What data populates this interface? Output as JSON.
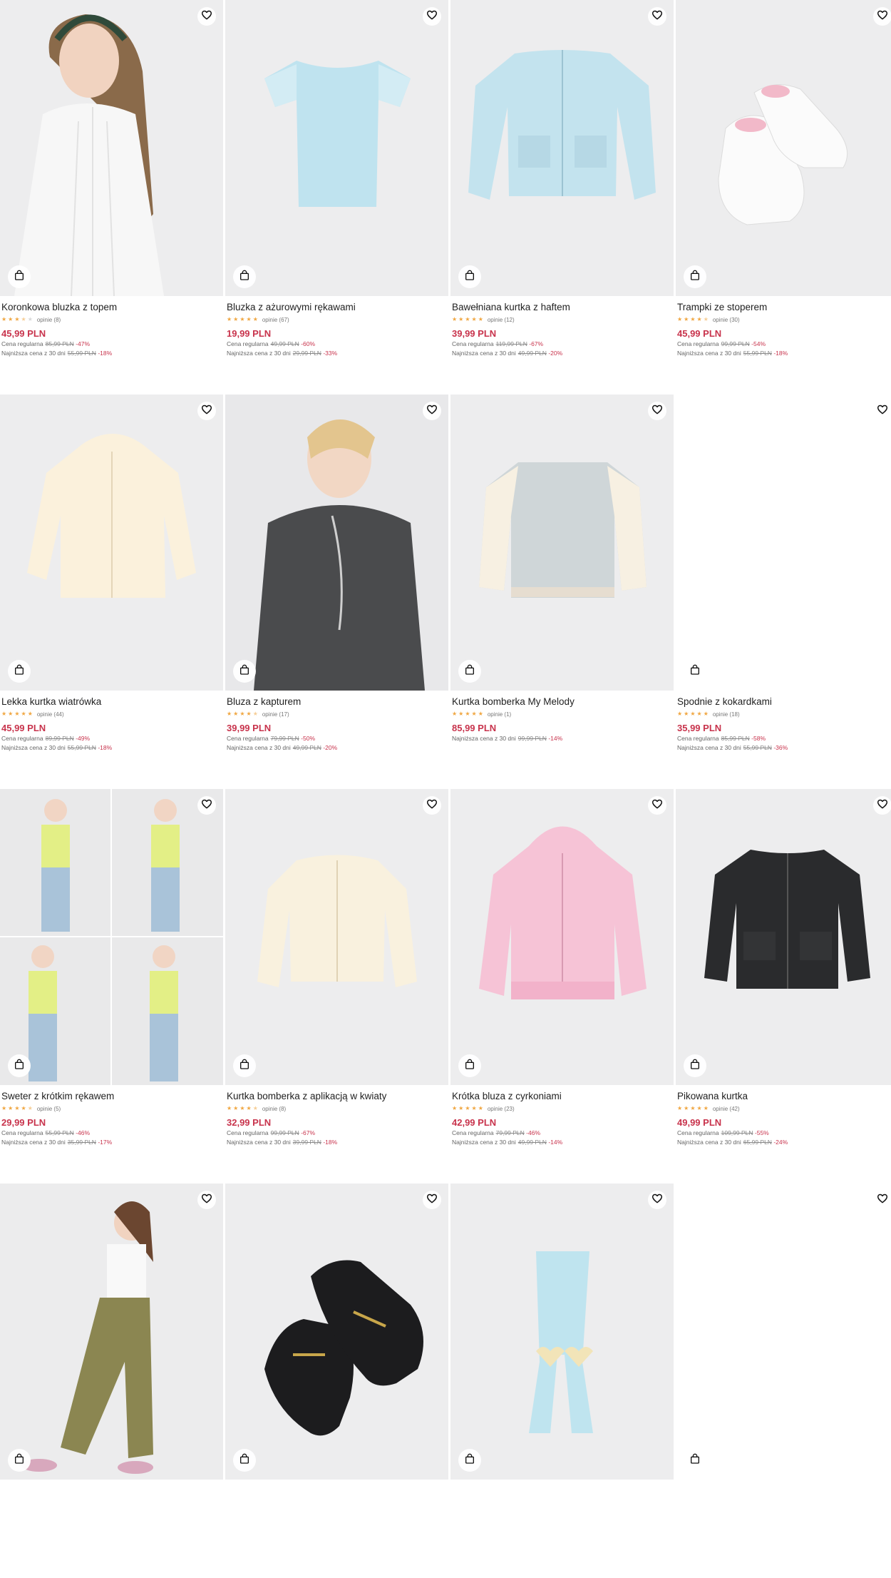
{
  "icons": {
    "wishlist": "heart-icon",
    "cart": "shopping-bag-icon",
    "rating": "star-icon"
  },
  "colors": {
    "price": "#c8334c",
    "star": "#f0a640",
    "image_bg": "#eeeeef"
  },
  "products": [
    {
      "name": "Koronkowa bluzka z topem",
      "rating": 3.5,
      "reviews": "opinie (8)",
      "price": "45,99 PLN",
      "lines": [
        {
          "label": "Cena regularna",
          "old": "85,99 PLN",
          "disc": "-47%"
        },
        {
          "label": "Najniższa cena z 30 dni",
          "old": "55,99 PLN",
          "disc": "-18%"
        }
      ]
    },
    {
      "name": "Bluzka z ażurowymi rękawami",
      "rating": 5,
      "reviews": "opinie (67)",
      "price": "19,99 PLN",
      "lines": [
        {
          "label": "Cena regularna",
          "old": "49,99 PLN",
          "disc": "-60%"
        },
        {
          "label": "Najniższa cena z 30 dni",
          "old": "29,99 PLN",
          "disc": "-33%"
        }
      ]
    },
    {
      "name": "Bawełniana kurtka z haftem",
      "rating": 5,
      "reviews": "opinie (12)",
      "price": "39,99 PLN",
      "lines": [
        {
          "label": "Cena regularna",
          "old": "119,99 PLN",
          "disc": "-67%"
        },
        {
          "label": "Najniższa cena z 30 dni",
          "old": "49,99 PLN",
          "disc": "-20%"
        }
      ]
    },
    {
      "name": "Trampki ze stoperem",
      "rating": 4.5,
      "reviews": "opinie (30)",
      "price": "45,99 PLN",
      "lines": [
        {
          "label": "Cena regularna",
          "old": "99,99 PLN",
          "disc": "-54%"
        },
        {
          "label": "Najniższa cena z 30 dni",
          "old": "55,99 PLN",
          "disc": "-18%"
        }
      ]
    },
    {
      "name": "Lekka kurtka wiatrówka",
      "rating": 5,
      "reviews": "opinie (44)",
      "price": "45,99 PLN",
      "lines": [
        {
          "label": "Cena regularna",
          "old": "89,99 PLN",
          "disc": "-49%"
        },
        {
          "label": "Najniższa cena z 30 dni",
          "old": "55,99 PLN",
          "disc": "-18%"
        }
      ]
    },
    {
      "name": "Bluza z kapturem",
      "rating": 4.5,
      "reviews": "opinie (17)",
      "price": "39,99 PLN",
      "lines": [
        {
          "label": "Cena regularna",
          "old": "79,99 PLN",
          "disc": "-50%"
        },
        {
          "label": "Najniższa cena z 30 dni",
          "old": "49,99 PLN",
          "disc": "-20%"
        }
      ]
    },
    {
      "name": "Kurtka bomberka My Melody",
      "rating": 5,
      "reviews": "opinie (1)",
      "price": "85,99 PLN",
      "lines": [
        {
          "label": "Najniższa cena z 30 dni",
          "old": "99,99 PLN",
          "disc": "-14%"
        }
      ]
    },
    {
      "name": "Spodnie z kokardkami",
      "rating": 5,
      "reviews": "opinie (18)",
      "price": "35,99 PLN",
      "lines": [
        {
          "label": "Cena regularna",
          "old": "85,99 PLN",
          "disc": "-58%"
        },
        {
          "label": "Najniższa cena z 30 dni",
          "old": "55,99 PLN",
          "disc": "-36%"
        }
      ]
    },
    {
      "name": "Sweter z krótkim rękawem",
      "rating": 4.5,
      "reviews": "opinie (5)",
      "price": "29,99 PLN",
      "lines": [
        {
          "label": "Cena regularna",
          "old": "55,99 PLN",
          "disc": "-46%"
        },
        {
          "label": "Najniższa cena z 30 dni",
          "old": "35,99 PLN",
          "disc": "-17%"
        }
      ]
    },
    {
      "name": "Kurtka bomberka z aplikacją w kwiaty",
      "rating": 4.5,
      "reviews": "opinie (8)",
      "price": "32,99 PLN",
      "lines": [
        {
          "label": "Cena regularna",
          "old": "99,99 PLN",
          "disc": "-67%"
        },
        {
          "label": "Najniższa cena z 30 dni",
          "old": "39,99 PLN",
          "disc": "-18%"
        }
      ]
    },
    {
      "name": "Krótka bluza z cyrkoniami",
      "rating": 5,
      "reviews": "opinie (23)",
      "price": "42,99 PLN",
      "lines": [
        {
          "label": "Cena regularna",
          "old": "79,99 PLN",
          "disc": "-46%"
        },
        {
          "label": "Najniższa cena z 30 dni",
          "old": "49,99 PLN",
          "disc": "-14%"
        }
      ]
    },
    {
      "name": "Pikowana kurtka",
      "rating": 5,
      "reviews": "opinie (42)",
      "price": "49,99 PLN",
      "lines": [
        {
          "label": "Cena regularna",
          "old": "109,99 PLN",
          "disc": "-55%"
        },
        {
          "label": "Najniższa cena z 30 dni",
          "old": "65,99 PLN",
          "disc": "-24%"
        }
      ]
    },
    {
      "name": "",
      "rating": 0,
      "reviews": "",
      "price": "",
      "lines": []
    },
    {
      "name": "",
      "rating": 0,
      "reviews": "",
      "price": "",
      "lines": []
    },
    {
      "name": "",
      "rating": 0,
      "reviews": "",
      "price": "",
      "lines": []
    },
    {
      "name": "",
      "rating": 0,
      "reviews": "",
      "price": "",
      "lines": []
    }
  ]
}
